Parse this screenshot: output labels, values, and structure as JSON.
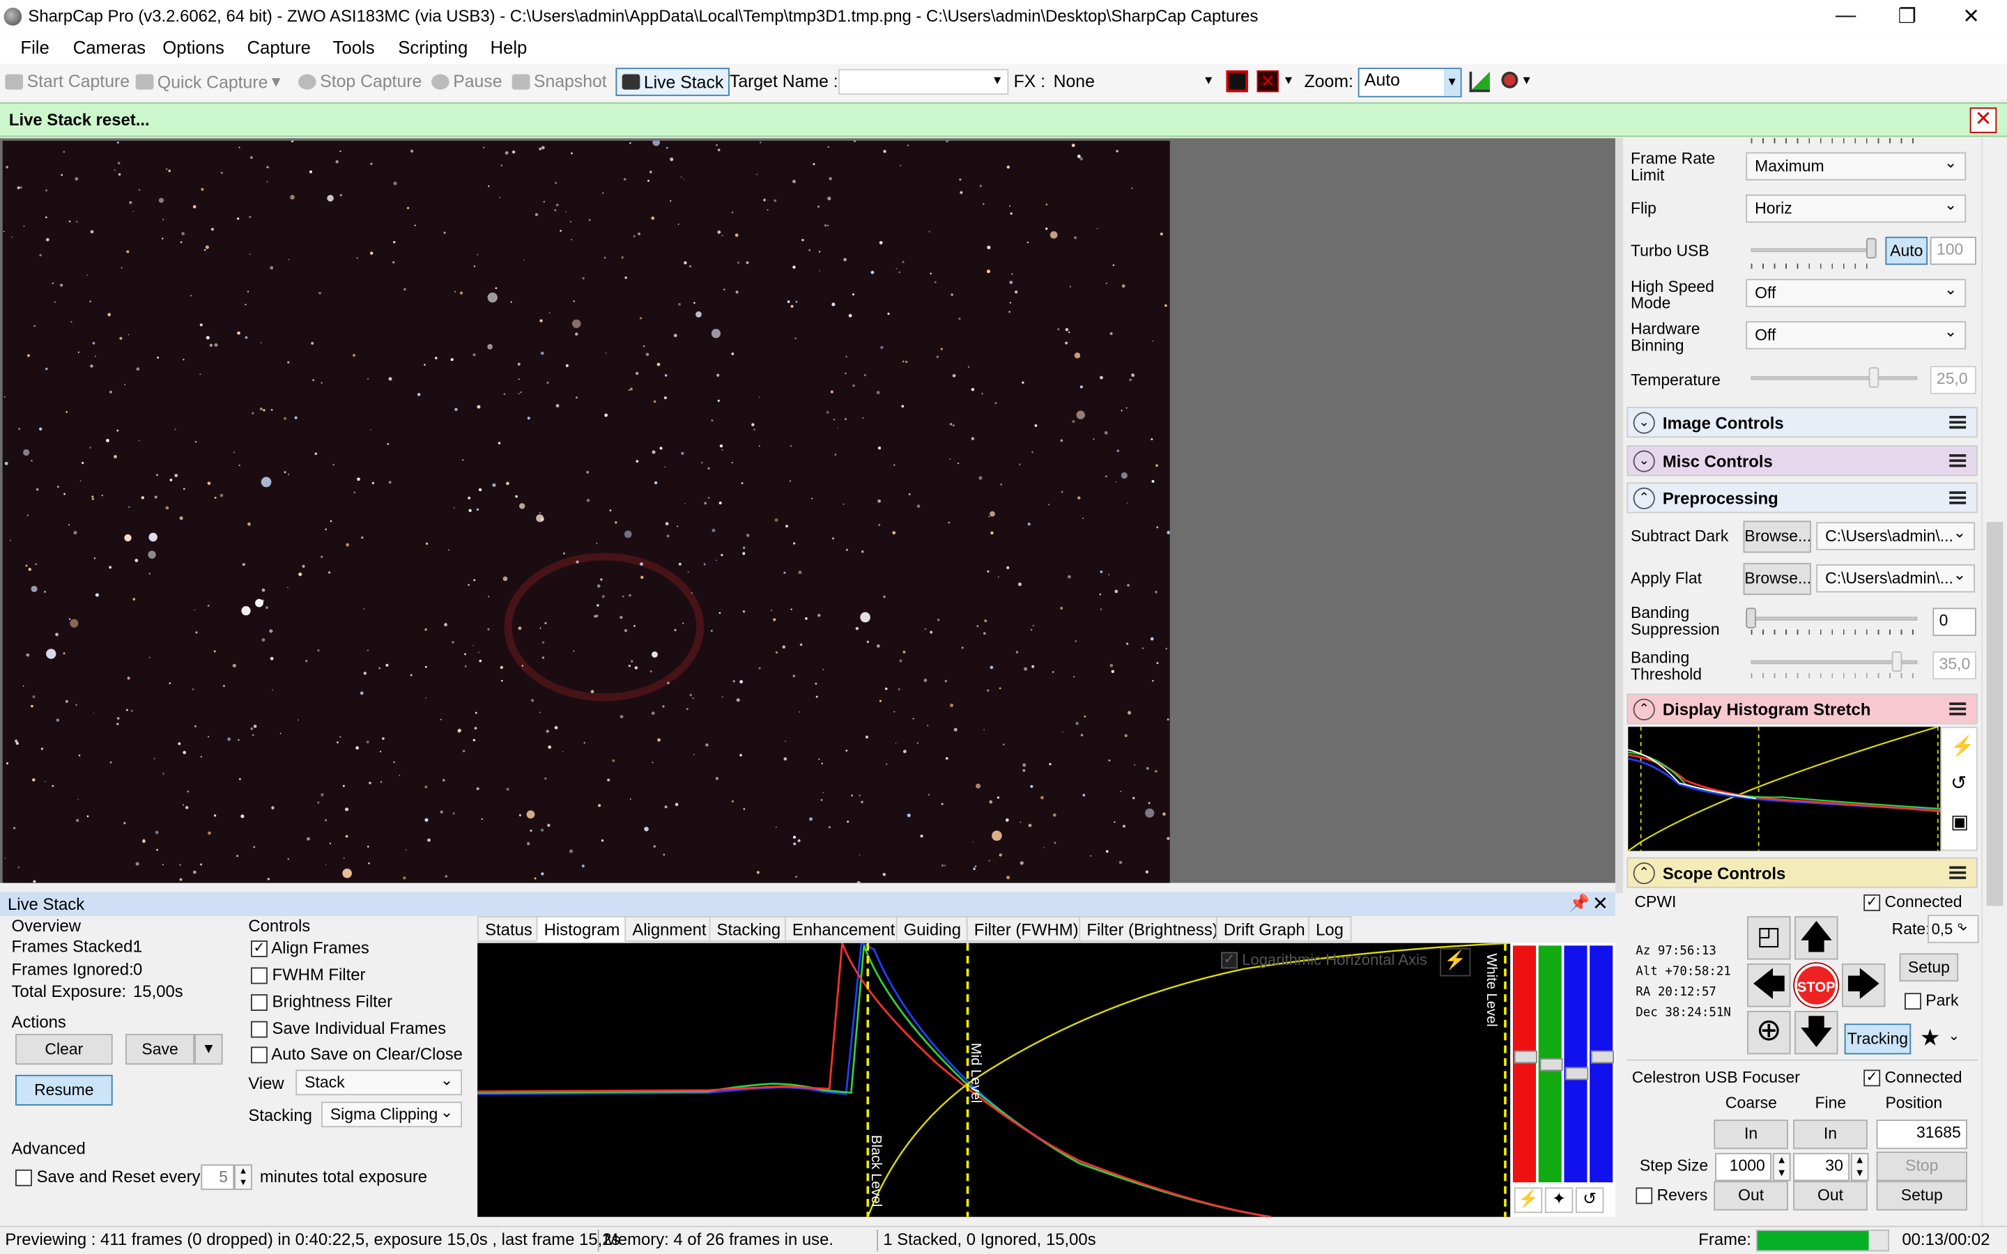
{
  "title": "SharpCap Pro (v3.2.6062, 64 bit) - ZWO ASI183MC (via USB3) - C:\\Users\\admin\\AppData\\Local\\Temp\\tmp3D1.tmp.png - C:\\Users\\admin\\Desktop\\SharpCap Captures",
  "menu": [
    "File",
    "Cameras",
    "Options",
    "Capture",
    "Tools",
    "Scripting",
    "Help"
  ],
  "toolbar": {
    "start_capture": "Start Capture",
    "quick_capture": "Quick Capture",
    "stop_capture": "Stop Capture",
    "pause": "Pause",
    "snapshot": "Snapshot",
    "live_stack": "Live Stack",
    "target_name_label": "Target Name :",
    "fx_label": "FX :",
    "fx_value": "None",
    "zoom_label": "Zoom:",
    "zoom_value": "Auto"
  },
  "notice": "Live Stack reset...",
  "camera_controls": {
    "frame_rate_label": "Frame Rate Limit",
    "frame_rate_value": "Maximum",
    "flip_label": "Flip",
    "flip_value": "Horiz",
    "turbo_label": "Turbo USB",
    "turbo_auto": "Auto",
    "turbo_value": "100",
    "high_speed_label": "High Speed Mode",
    "high_speed_value": "Off",
    "binning_label": "Hardware Binning",
    "binning_value": "Off",
    "temperature_label": "Temperature",
    "temperature_value": "25,0"
  },
  "sections": {
    "image_controls": "Image Controls",
    "misc_controls": "Misc Controls",
    "preprocessing": "Preprocessing",
    "histogram_stretch": "Display Histogram Stretch",
    "scope_controls": "Scope Controls"
  },
  "preprocessing": {
    "subtract_dark_label": "Subtract Dark",
    "apply_flat_label": "Apply Flat",
    "browse": "Browse...",
    "dark_path": "C:\\Users\\admin\\...",
    "flat_path": "C:\\Users\\admin\\...",
    "banding_suppression_label": "Banding Suppression",
    "banding_suppression_value": "0",
    "banding_threshold_label": "Banding Threshold",
    "banding_threshold_value": "35,0"
  },
  "scope": {
    "mount": "CPWI",
    "connected": "Connected",
    "rate_label": "Rate:",
    "rate_value": "0,5 °",
    "setup": "Setup",
    "park": "Park",
    "tracking": "Tracking",
    "stop": "STOP",
    "az": "Az  97:56:13",
    "alt": "Alt +70:58:21",
    "ra": "RA  20:12:57",
    "dec": "Dec 38:24:51N"
  },
  "focuser": {
    "name": "Celestron USB Focuser",
    "connected": "Connected",
    "coarse": "Coarse",
    "fine": "Fine",
    "position_label": "Position",
    "in": "In",
    "out": "Out",
    "position": "31685",
    "step_size_label": "Step Size",
    "coarse_step": "1000",
    "fine_step": "30",
    "stop": "Stop",
    "setup": "Setup",
    "reverse": "Reverse"
  },
  "livestack": {
    "title": "Live Stack",
    "overview": "Overview",
    "frames_stacked_label": "Frames Stacked:",
    "frames_stacked": "1",
    "frames_ignored_label": "Frames Ignored:",
    "frames_ignored": "0",
    "total_exposure_label": "Total Exposure:",
    "total_exposure": "15,00s",
    "actions": "Actions",
    "clear": "Clear",
    "save": "Save",
    "resume": "Resume",
    "advanced": "Advanced",
    "save_reset_label": "Save and Reset every",
    "save_reset_minutes": "5",
    "save_reset_suffix": "minutes total exposure",
    "controls": "Controls",
    "align_frames": "Align Frames",
    "fwhm_filter": "FWHM Filter",
    "brightness_filter": "Brightness Filter",
    "save_individual": "Save Individual Frames",
    "auto_save": "Auto Save on Clear/Close",
    "view_label": "View",
    "view_value": "Stack",
    "stacking_label": "Stacking",
    "stacking_value": "Sigma Clipping",
    "tabs": [
      "Status",
      "Histogram",
      "Alignment",
      "Stacking",
      "Enhancement",
      "Guiding",
      "Filter (FWHM)",
      "Filter (Brightness)",
      "Drift Graph",
      "Log"
    ],
    "log_axis": "Logarithmic Horizontal Axis",
    "black_level": "Black Level",
    "mid_level": "Mid Level",
    "white_level": "White Level"
  },
  "status": {
    "previewing": "Previewing : 411 frames (0 dropped) in 0:40:22,5, exposure 15,0s , last frame 15,2s",
    "memory": "Memory: 4 of 26 frames in use.",
    "stacked": "1 Stacked, 0 Ignored, 15,00s",
    "frame_label": "Frame:",
    "frame_time": "00:13/00:02"
  }
}
